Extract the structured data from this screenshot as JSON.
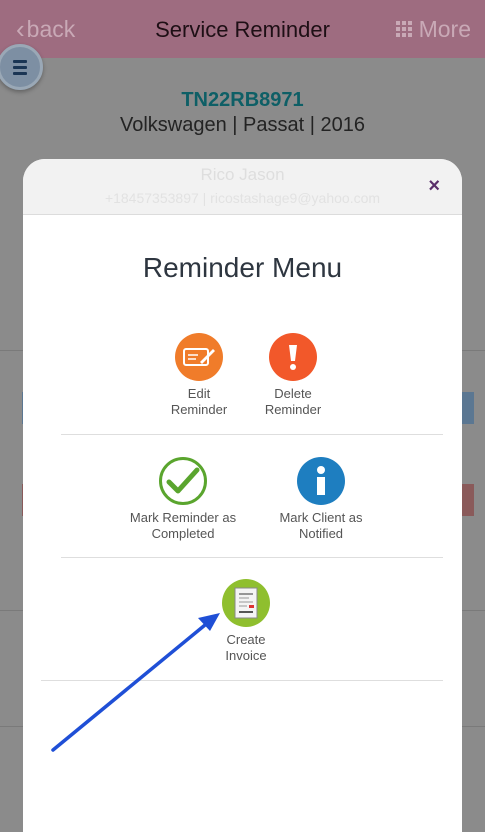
{
  "header": {
    "back_label": "back",
    "title": "Service Reminder",
    "more_label": "More"
  },
  "vehicle": {
    "plate": "TN22RB8971",
    "description": "Volkswagen | Passat | 2016"
  },
  "client": {
    "name": "Rico Jason",
    "contact": "+18457353897 | ricostashage9@yahoo.com"
  },
  "modal": {
    "close": "×",
    "title": "Reminder Menu",
    "options": {
      "edit": {
        "line1": "Edit",
        "line2": "Reminder",
        "icon": "edit-pen-icon",
        "color": "#f07c2a"
      },
      "delete": {
        "line1": "Delete",
        "line2": "Reminder",
        "icon": "exclamation-icon",
        "color": "#f2582a"
      },
      "complete": {
        "line1": "Mark Reminder as",
        "line2": "Completed",
        "icon": "checkmark-icon",
        "color": "#5aa52e"
      },
      "notified": {
        "line1": "Mark Client as",
        "line2": "Notified",
        "icon": "info-icon",
        "color": "#1e7ec0"
      },
      "invoice": {
        "line1": "Create",
        "line2": "Invoice",
        "icon": "invoice-document-icon",
        "color": "#8fbf2e"
      }
    }
  },
  "colors": {
    "header_bg": "#9e6c80",
    "plate_text": "#0e5f66",
    "arrow": "#1f4fd6"
  }
}
